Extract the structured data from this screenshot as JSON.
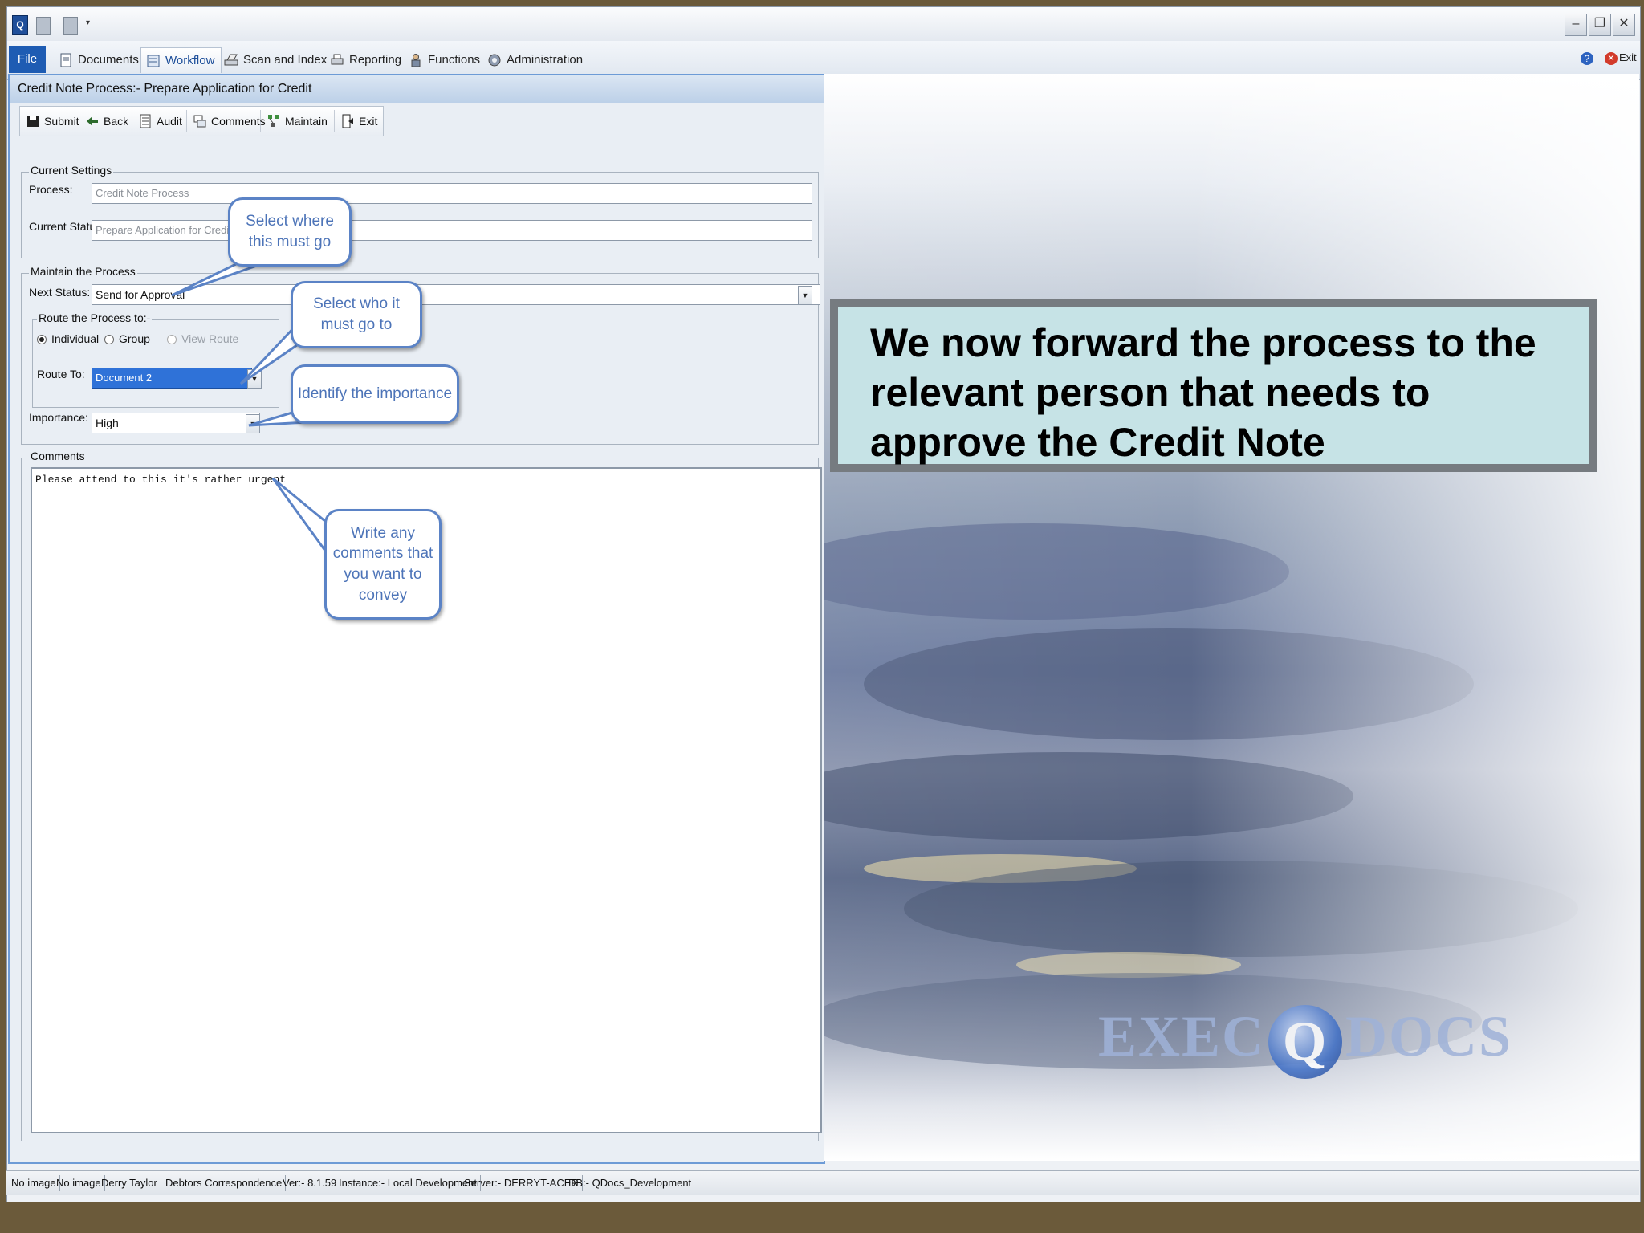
{
  "ribbon": {
    "tabs": [
      "File",
      "Documents",
      "Workflow",
      "Scan and Index",
      "Reporting",
      "Functions",
      "Administration"
    ],
    "help_exit_label": "Exit"
  },
  "panel": {
    "title": "Credit Note Process:- Prepare Application for Credit",
    "toolbar": [
      "Submit",
      "Back",
      "Audit",
      "Comments",
      "Maintain",
      "Exit"
    ],
    "current_settings": {
      "legend": "Current Settings",
      "process_label": "Process:",
      "process_value": "Credit Note Process",
      "status_label": "Current Status:",
      "status_value": "Prepare Application for Credit"
    },
    "maintain": {
      "legend": "Maintain the Process",
      "next_status_label": "Next Status:",
      "next_status_value": "Send for Approval",
      "route_legend": "Route the Process to:-",
      "radio_individual": "Individual",
      "radio_group": "Group",
      "radio_view_route": "View Route",
      "route_to_label": "Route To:",
      "route_to_value": "Document 2",
      "importance_label": "Importance:",
      "importance_value": "High"
    },
    "comments": {
      "legend": "Comments",
      "text": "Please attend to this it's rather urgent"
    }
  },
  "callouts": {
    "where": "Select where this must go",
    "who": "Select who it must go to",
    "importance": "Identify the importance",
    "comments": "Write any comments that you want to convey"
  },
  "message": "We now forward the process to the relevant person that needs to approve the Credit Note",
  "logo": {
    "left": "EXEC",
    "q": "Q",
    "right": "DOCS"
  },
  "statusbar": [
    "No image",
    "No image",
    "Derry Taylor",
    "Debtors Correspondence",
    "Ver:- 8.1.59",
    "Instance:- Local Development",
    "Server:- DERRYT-ACER",
    "DB:- QDocs_Development"
  ]
}
